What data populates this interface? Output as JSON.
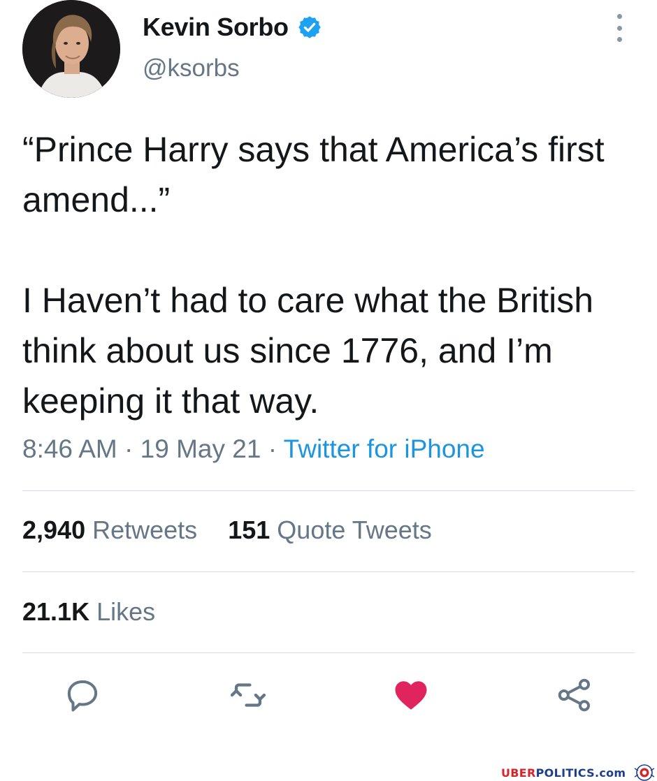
{
  "author": {
    "display_name": "Kevin Sorbo",
    "handle": "@ksorbs",
    "avatar": "profile-photo",
    "verified_icon": "verified-badge-icon",
    "verified_color": "#1da1f2"
  },
  "menu": {
    "icon": "more-vertical-icon"
  },
  "tweet": {
    "text": "“Prince Harry says that America’s first amend...”\n\nI Haven’t had to care what the British think about us since 1776, and I’m keeping it that way."
  },
  "meta": {
    "time": "8:46 AM",
    "separator": "·",
    "date": "19 May 21",
    "source": "Twitter for iPhone"
  },
  "stats": {
    "retweets_count": "2,940",
    "retweets_label": "Retweets",
    "quotes_count": "151",
    "quotes_label": "Quote Tweets",
    "likes_count": "21.1K",
    "likes_label": "Likes"
  },
  "actions": {
    "reply_icon": "reply-icon",
    "retweet_icon": "retweet-icon",
    "like_icon": "heart-icon",
    "share_icon": "share-icon",
    "like_color": "#e0245e",
    "icon_color": "#657786"
  },
  "watermark": {
    "brand_prefix": "UBER",
    "brand_rest": "POLITICS.com",
    "prefix_color": "#d8232a",
    "rest_color": "#1d3f8f"
  }
}
